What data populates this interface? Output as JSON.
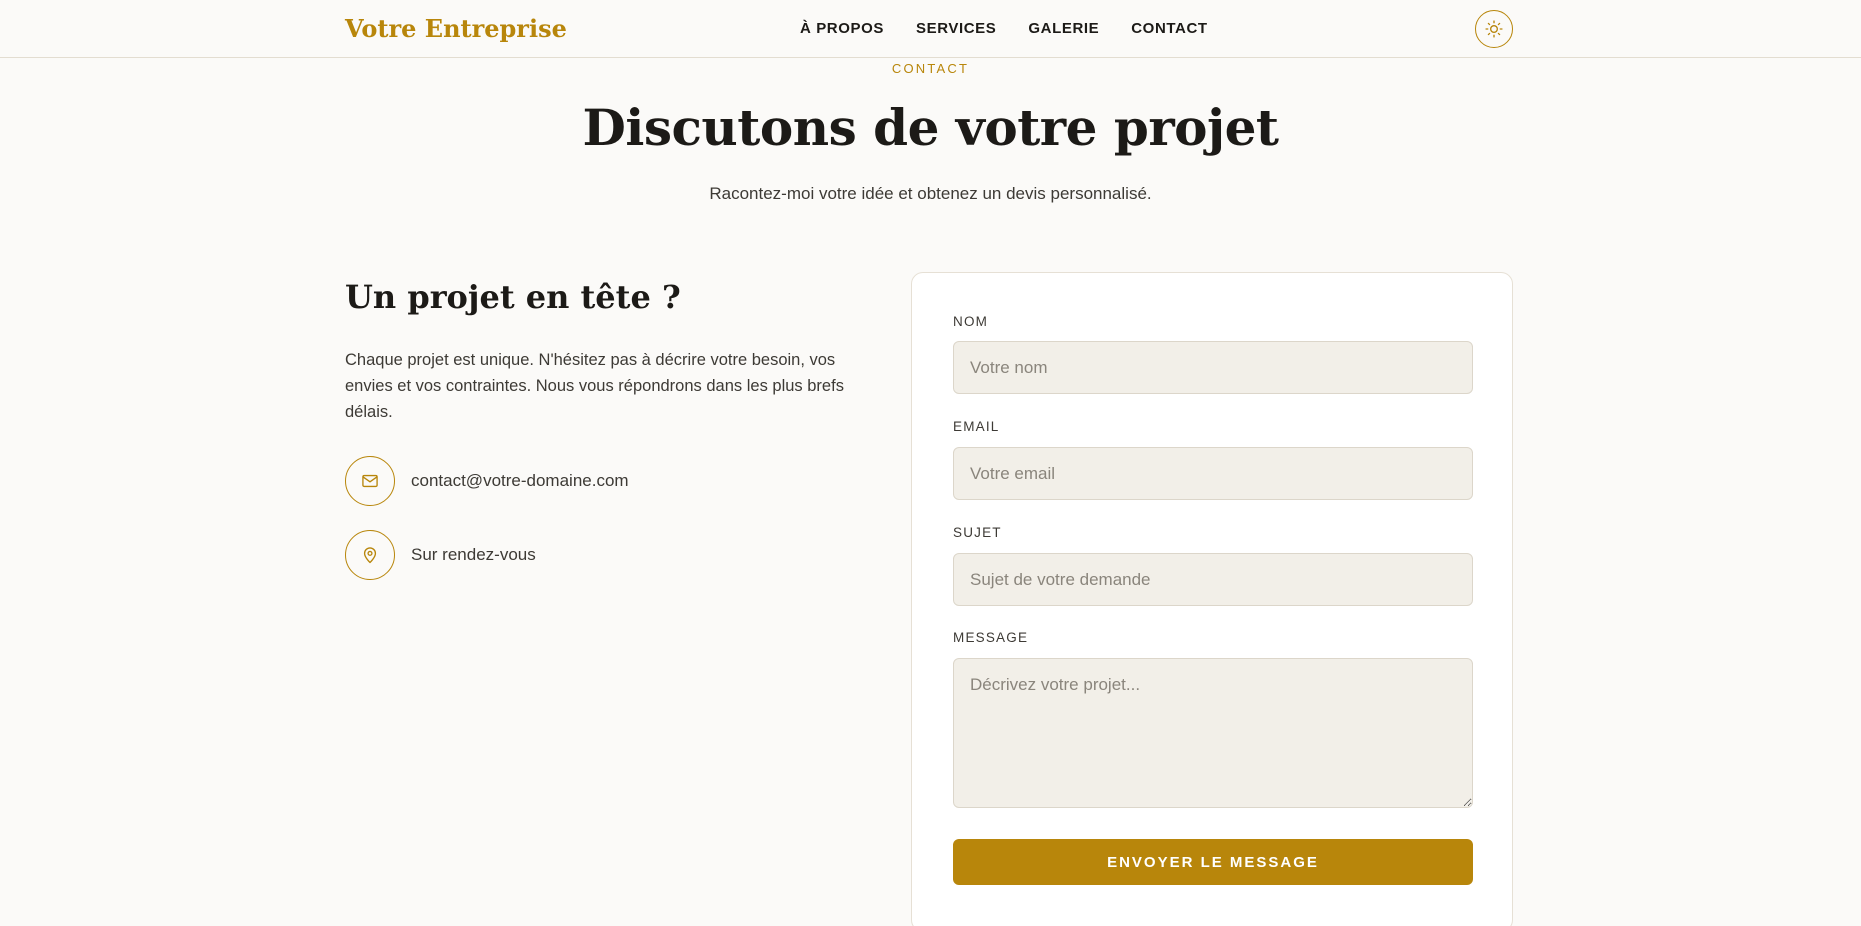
{
  "header": {
    "logo": "Votre Entreprise",
    "nav": [
      "À PROPOS",
      "SERVICES",
      "GALERIE",
      "CONTACT"
    ],
    "theme_icon": "sun-icon"
  },
  "hero": {
    "eyebrow": "CONTACT",
    "title": "Discutons de votre projet",
    "subtitle": "Racontez-moi votre idée et obtenez un devis personnalisé."
  },
  "info": {
    "title": "Un projet en tête ?",
    "description": "Chaque projet est unique. N'hésitez pas à décrire votre besoin, vos envies et vos contraintes. Nous vous répondrons dans les plus brefs délais.",
    "email": "contact@votre-domaine.com",
    "email_icon": "mail-icon",
    "location": "Sur rendez-vous",
    "location_icon": "map-pin-icon"
  },
  "form": {
    "name_label": "NOM",
    "name_placeholder": "Votre nom",
    "email_label": "EMAIL",
    "email_placeholder": "Votre email",
    "subject_label": "SUJET",
    "subject_placeholder": "Sujet de votre demande",
    "message_label": "MESSAGE",
    "message_placeholder": "Décrivez votre projet...",
    "submit_label": "ENVOYER LE MESSAGE"
  },
  "colors": {
    "accent": "#b8860b",
    "background": "#fbfaf8",
    "input_background": "#f2efe8",
    "text": "#1c1a17"
  }
}
